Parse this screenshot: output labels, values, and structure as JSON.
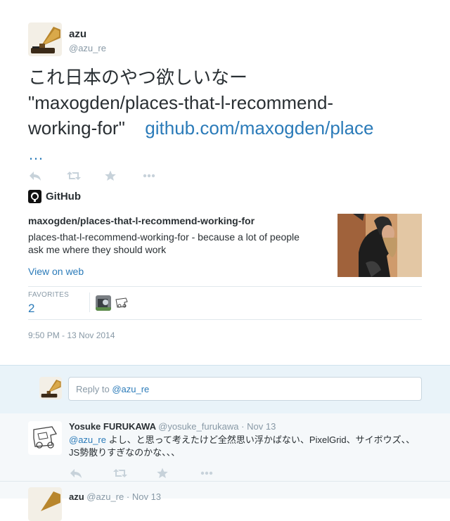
{
  "colors": {
    "link": "#2b7bb9",
    "muted": "#8899a6",
    "reply_bg": "#e9f3f9",
    "replies_bg": "#f5f8fa"
  },
  "tweet": {
    "author_name": "azu",
    "author_handle": "@azu_re",
    "text_line1": "これ日本のやつ欲しいなー",
    "text_line2": "\"maxogden/places-that-l-recommend-",
    "text_line3": "working-for\"",
    "link_text": "github.com/maxogden/place",
    "ellipsis": "…",
    "actions": [
      "reply-icon",
      "retweet-icon",
      "favorite-icon",
      "more-icon"
    ]
  },
  "card": {
    "source_icon": "github-icon",
    "source": "GitHub",
    "title": "maxogden/places-that-l-recommend-working-for",
    "description": "places-that-l-recommend-working-for - because a lot of people ask me where they should work",
    "view_link": "View on web"
  },
  "favorites": {
    "label": "FAVORITES",
    "count": "2"
  },
  "timestamp": "9:50 PM - 13 Nov 2014",
  "reply_box": {
    "prefix": "Reply to ",
    "handle": "@azu_re"
  },
  "replies": [
    {
      "name": "Yosuke FURUKAWA",
      "handle": "@yosuke_furukawa",
      "date": "Nov 13",
      "mention": "@azu_re",
      "text": " よし、と思って考えたけど全然思い浮かばない、PixelGrid、サイボウズ、、JS勢散りすぎなのかな、、、"
    },
    {
      "name": "azu",
      "handle": "@azu_re",
      "date": "Nov 13"
    }
  ]
}
